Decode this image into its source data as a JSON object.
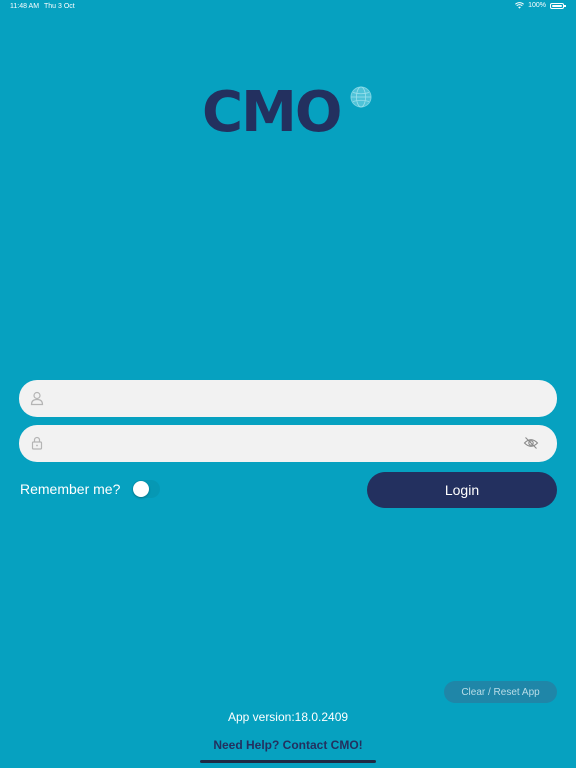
{
  "status_bar": {
    "time": "11:48 AM",
    "date": "Thu 3 Oct",
    "battery": "100%"
  },
  "logo": {
    "text": "CMO"
  },
  "form": {
    "username_placeholder": "",
    "password_placeholder": "",
    "remember_label": "Remember me?",
    "remember_on": false,
    "login_label": "Login"
  },
  "footer": {
    "reset_label": "Clear / Reset App",
    "app_version": "App version:18.0.2409",
    "help_link": "Need Help? Contact CMO!"
  },
  "colors": {
    "background": "#06a1c0",
    "brand_navy": "#23305f",
    "field_bg": "#f2f2f2"
  },
  "icons": {
    "username": "user-icon",
    "password": "lock-icon",
    "visibility": "eye-slash-icon",
    "wifi": "wifi-icon",
    "battery": "battery-icon"
  }
}
